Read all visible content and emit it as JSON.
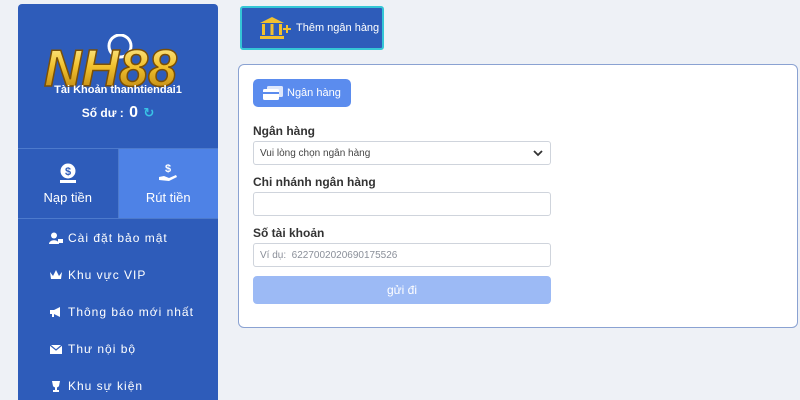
{
  "sidebar": {
    "logo_text": "NH88",
    "account_label": "Tài Khoản thanhtiendai1",
    "balance_label": "Số dư :",
    "balance_value": "0",
    "actions": [
      {
        "label": "Nạp tiền",
        "icon": "deposit-icon"
      },
      {
        "label": "Rút tiền",
        "icon": "withdraw-icon"
      }
    ],
    "menu": [
      {
        "label": "Cài đặt bảo mật",
        "icon": "user-lock-icon"
      },
      {
        "label": "Khu vực VIP",
        "icon": "crown-icon"
      },
      {
        "label": "Thông báo mới nhất",
        "icon": "megaphone-icon"
      },
      {
        "label": "Thư nội bộ",
        "icon": "envelope-icon"
      },
      {
        "label": "Khu sự kiện",
        "icon": "trophy-icon"
      }
    ]
  },
  "top_tab": {
    "label": "Thêm ngân hàng",
    "icon": "bank-add-icon"
  },
  "panel": {
    "bank_tab": {
      "label": "Ngân hàng",
      "icon": "bank-card-icon"
    },
    "bank_field": {
      "label": "Ngân hàng",
      "value": "Vui lòng chọn ngân hàng"
    },
    "branch_field": {
      "label": "Chi nhánh ngân hàng",
      "value": ""
    },
    "account_field": {
      "label": "Số tài khoản",
      "placeholder": "Ví dụ:  6227002020690175526"
    },
    "submit_label": "gửi đi"
  },
  "colors": {
    "sidebar": "#2e5cba",
    "accent": "#4e82e6",
    "tab_border": "#35c6d6",
    "submit": "#9cbaf5",
    "logo_gold": "#f2c12e"
  }
}
